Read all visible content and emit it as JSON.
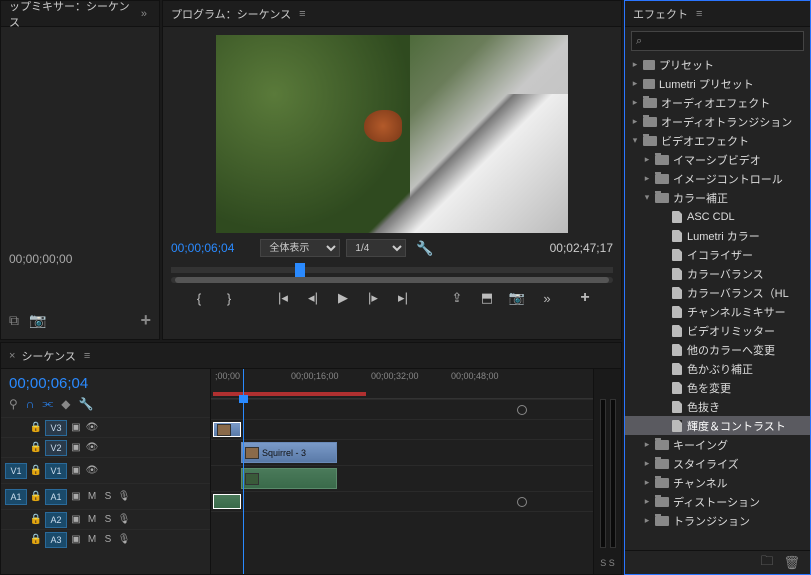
{
  "audiomixer": {
    "title": "ップミキサー：シーケンス",
    "timecode": "00;00;00;00"
  },
  "program": {
    "title": "プログラム：シーケンス",
    "tc_current": "00;00;06;04",
    "tc_duration": "00;02;47;17",
    "fit_label": "全体表示",
    "res_label": "1/4"
  },
  "effects": {
    "title": "エフェクト",
    "search_placeholder": "",
    "tree": {
      "presets": "プリセット",
      "lumetri_presets": "Lumetri プリセット",
      "audio_effects": "オーディオエフェクト",
      "audio_transitions": "オーディオトランジション",
      "video_effects": "ビデオエフェクト",
      "immersive": "イマーシブビデオ",
      "image_control": "イメージコントロール",
      "color_correction": "カラー補正",
      "items": {
        "asc_cdl": "ASC CDL",
        "lumetri_color": "Lumetri カラー",
        "equalize": "イコライザー",
        "color_balance": "カラーバランス",
        "color_balance_hls": "カラーバランス（HL",
        "channel_mixer": "チャンネルミキサー",
        "video_limiter": "ビデオリミッター",
        "change_to_color": "他のカラーへ変更",
        "tint": "色かぶり補正",
        "change_color": "色を変更",
        "color_remove": "色抜き",
        "brightness_contrast": "輝度＆コントラスト"
      },
      "keying": "キーイング",
      "stylize": "スタイライズ",
      "channel": "チャンネル",
      "distort": "ディストーション",
      "transition": "トランジション"
    }
  },
  "timeline": {
    "title": "シーケンス",
    "timecode": "00;00;06;04",
    "ruler": {
      "t0": ";00;00",
      "t1": "00;00;16;00",
      "t2": "00;00;32;00",
      "t3": "00;00;48;00"
    },
    "tracks": {
      "v3": "V3",
      "v2": "V2",
      "v1_src": "V1",
      "v1": "V1",
      "a1_src": "A1",
      "a1": "A1",
      "a2": "A2",
      "a3": "A3",
      "m": "M",
      "s": "S"
    },
    "clip_label": "Squirrel - 3",
    "meter_label": "S  S"
  }
}
